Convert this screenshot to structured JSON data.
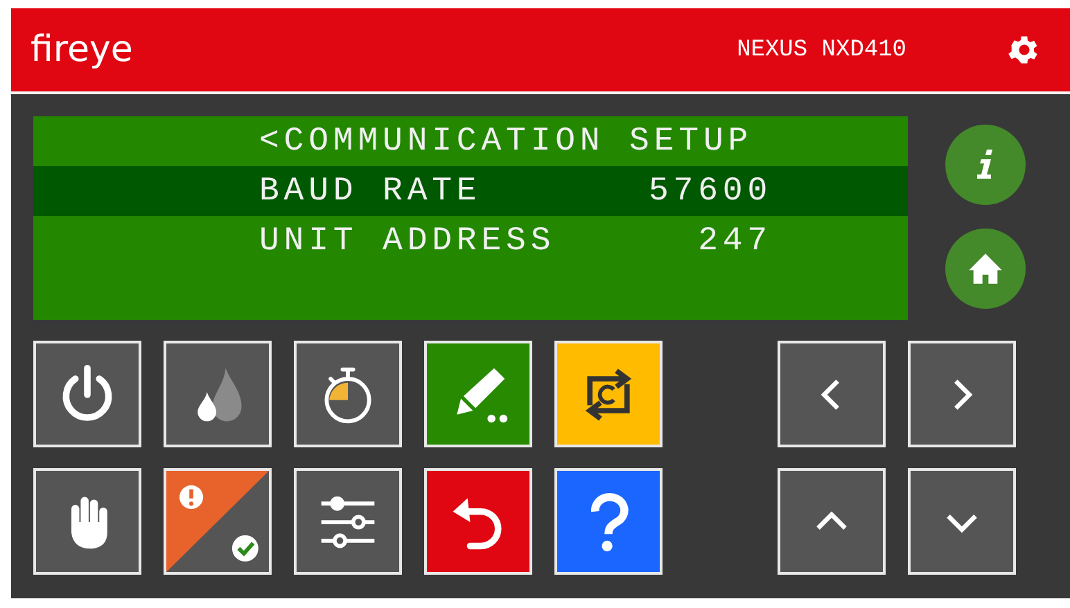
{
  "header": {
    "logo": "fireye",
    "model": "NEXUS NXD410"
  },
  "screen": {
    "rows": [
      {
        "label": "<COMMUNICATION SETUP",
        "value": "",
        "selected": false
      },
      {
        "label": "BAUD RATE",
        "value": "57600",
        "selected": true
      },
      {
        "label": "UNIT ADDRESS",
        "value": "247",
        "selected": false
      }
    ]
  },
  "side_buttons": [
    {
      "kind": "info"
    },
    {
      "kind": "home"
    }
  ],
  "buttons": [
    {
      "kind": "power",
      "color": "#555555"
    },
    {
      "kind": "flame",
      "color": "#555555"
    },
    {
      "kind": "timer",
      "color": "#555555"
    },
    {
      "kind": "edit",
      "color": "#288a00"
    },
    {
      "kind": "cycle",
      "color": "#ffbb00"
    },
    {
      "kind": "hand",
      "color": "#555555"
    },
    {
      "kind": "alarm",
      "color": "#555555"
    },
    {
      "kind": "sliders",
      "color": "#555555"
    },
    {
      "kind": "undo",
      "color": "#e00712"
    },
    {
      "kind": "help",
      "color": "#1a66ff"
    }
  ],
  "nav_buttons": [
    {
      "kind": "left"
    },
    {
      "kind": "right"
    },
    {
      "kind": "up"
    },
    {
      "kind": "down"
    }
  ]
}
